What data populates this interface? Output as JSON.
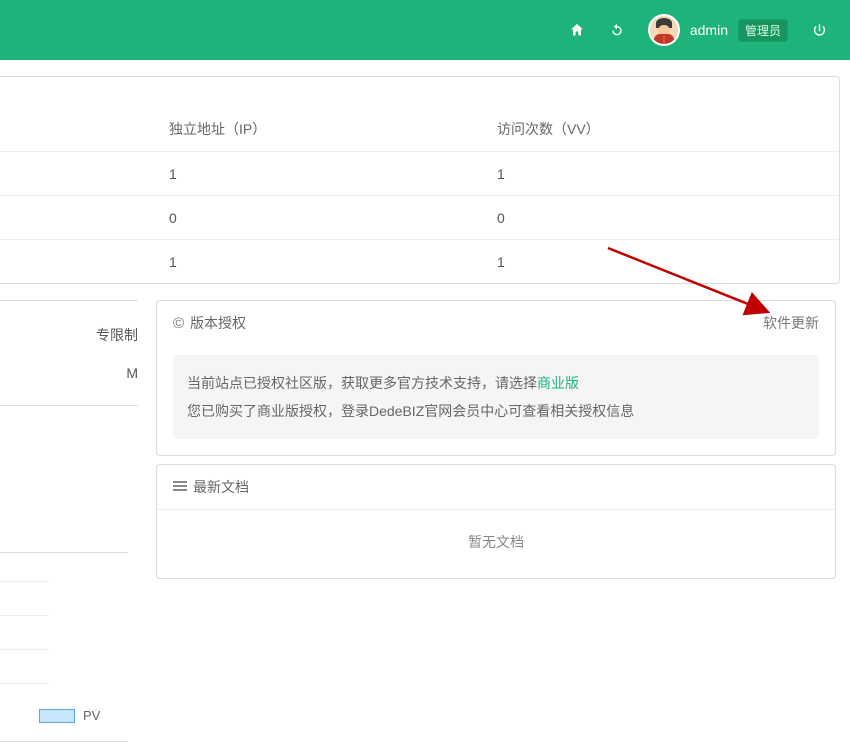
{
  "topbar": {
    "home_icon": "home-icon",
    "refresh_icon": "refresh-icon",
    "user_name": "admin",
    "role_badge": "管理员",
    "power_icon": "power-icon"
  },
  "stats": {
    "headers": {
      "ip": "独立地址（IP）",
      "vv": "访问次数（VV）"
    },
    "rows": [
      {
        "ip": "1",
        "vv": "1"
      },
      {
        "ip": "0",
        "vv": "0"
      },
      {
        "ip": "1",
        "vv": "1"
      }
    ]
  },
  "left_fragment": {
    "line1_suffix": "专限制",
    "line2_suffix": "M"
  },
  "version_card": {
    "title": "版本授权",
    "update_link": "软件更新",
    "notice_line1_prefix": "当前站点已授权社区版，获取更多官方技术支持，请选择",
    "notice_line1_link": "商业版",
    "notice_line2": "您已购买了商业版授权，登录DedeBIZ官网会员中心可查看相关授权信息"
  },
  "latest_card": {
    "title": "最新文档",
    "empty_text": "暂无文档"
  },
  "chart": {
    "legend_pv": "PV"
  },
  "colors": {
    "brand": "#1eb37b",
    "badge": "#18955f",
    "arrow": "#c00000"
  }
}
